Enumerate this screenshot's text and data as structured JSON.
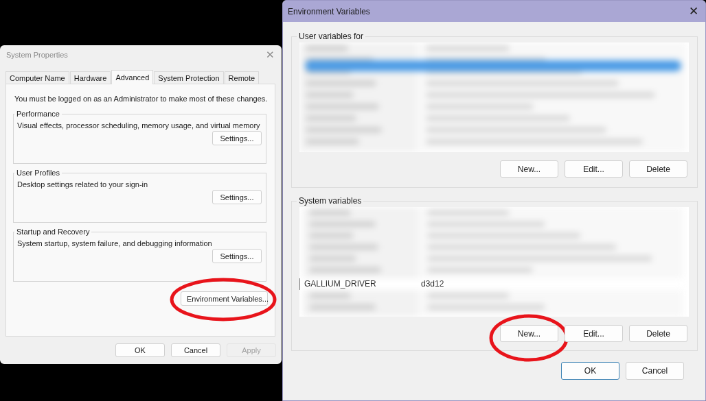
{
  "system_properties": {
    "title": "System Properties",
    "close": "✕",
    "tabs": [
      {
        "label": "Computer Name",
        "selected": false
      },
      {
        "label": "Hardware",
        "selected": false
      },
      {
        "label": "Advanced",
        "selected": true
      },
      {
        "label": "System Protection",
        "selected": false
      },
      {
        "label": "Remote",
        "selected": false
      }
    ],
    "notice": "You must be logged on as an Administrator to make most of these changes.",
    "groups": [
      {
        "title": "Performance",
        "description": "Visual effects, processor scheduling, memory usage, and virtual memory",
        "button": "Settings..."
      },
      {
        "title": "User Profiles",
        "description": "Desktop settings related to your sign-in",
        "button": "Settings..."
      },
      {
        "title": "Startup and Recovery",
        "description": "System startup, system failure, and debugging information",
        "button": "Settings..."
      }
    ],
    "environment_button": {
      "label": "Environment Variables...",
      "circled": true
    },
    "buttons": [
      {
        "label": "OK",
        "disabled": false
      },
      {
        "label": "Cancel",
        "disabled": false
      },
      {
        "label": "Apply",
        "disabled": true
      }
    ]
  },
  "environment_variables": {
    "title": "Environment Variables",
    "close": "✕",
    "user_group": {
      "title": "User variables for",
      "buttons": [
        {
          "label": "New...",
          "circled": false
        },
        {
          "label": "Edit...",
          "circled": false
        },
        {
          "label": "Delete",
          "circled": false
        }
      ]
    },
    "system_group": {
      "title": "System variables",
      "rows": [
        {
          "name": "GALLIUM_DRIVER",
          "value": "d3d12"
        }
      ],
      "buttons": [
        {
          "label": "New...",
          "circled": true
        },
        {
          "label": "Edit...",
          "circled": false
        },
        {
          "label": "Delete",
          "circled": false
        }
      ]
    },
    "buttons": [
      {
        "label": "OK",
        "default": true
      },
      {
        "label": "Cancel",
        "default": false
      }
    ]
  }
}
